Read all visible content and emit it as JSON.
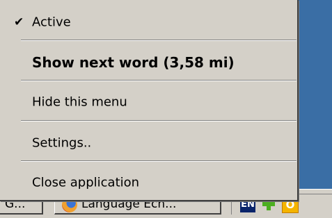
{
  "menu": {
    "items": [
      {
        "label": "Active",
        "checked": true,
        "bold": false
      },
      {
        "label": "Show next word (3,58 mi)",
        "checked": false,
        "bold": true
      },
      {
        "label": "Hide this menu",
        "checked": false,
        "bold": false
      },
      {
        "label": "Settings..",
        "checked": false,
        "bold": false
      },
      {
        "label": "Close application",
        "checked": false,
        "bold": false
      }
    ],
    "check_icon": "✔"
  },
  "taskbar": {
    "left_button_label": "G...",
    "browser_button_label": "Language Ech...",
    "browser_icon": "firefox-icon",
    "tray": {
      "language": "EN",
      "green_icon": "puzzle-icon",
      "orange_icon_label": "O"
    }
  },
  "colors": {
    "desktop": "#3a6ea5",
    "menu_background": "#d4d0c8",
    "language_indicator": "#0a246a",
    "tray_orange": "#f4b400"
  }
}
